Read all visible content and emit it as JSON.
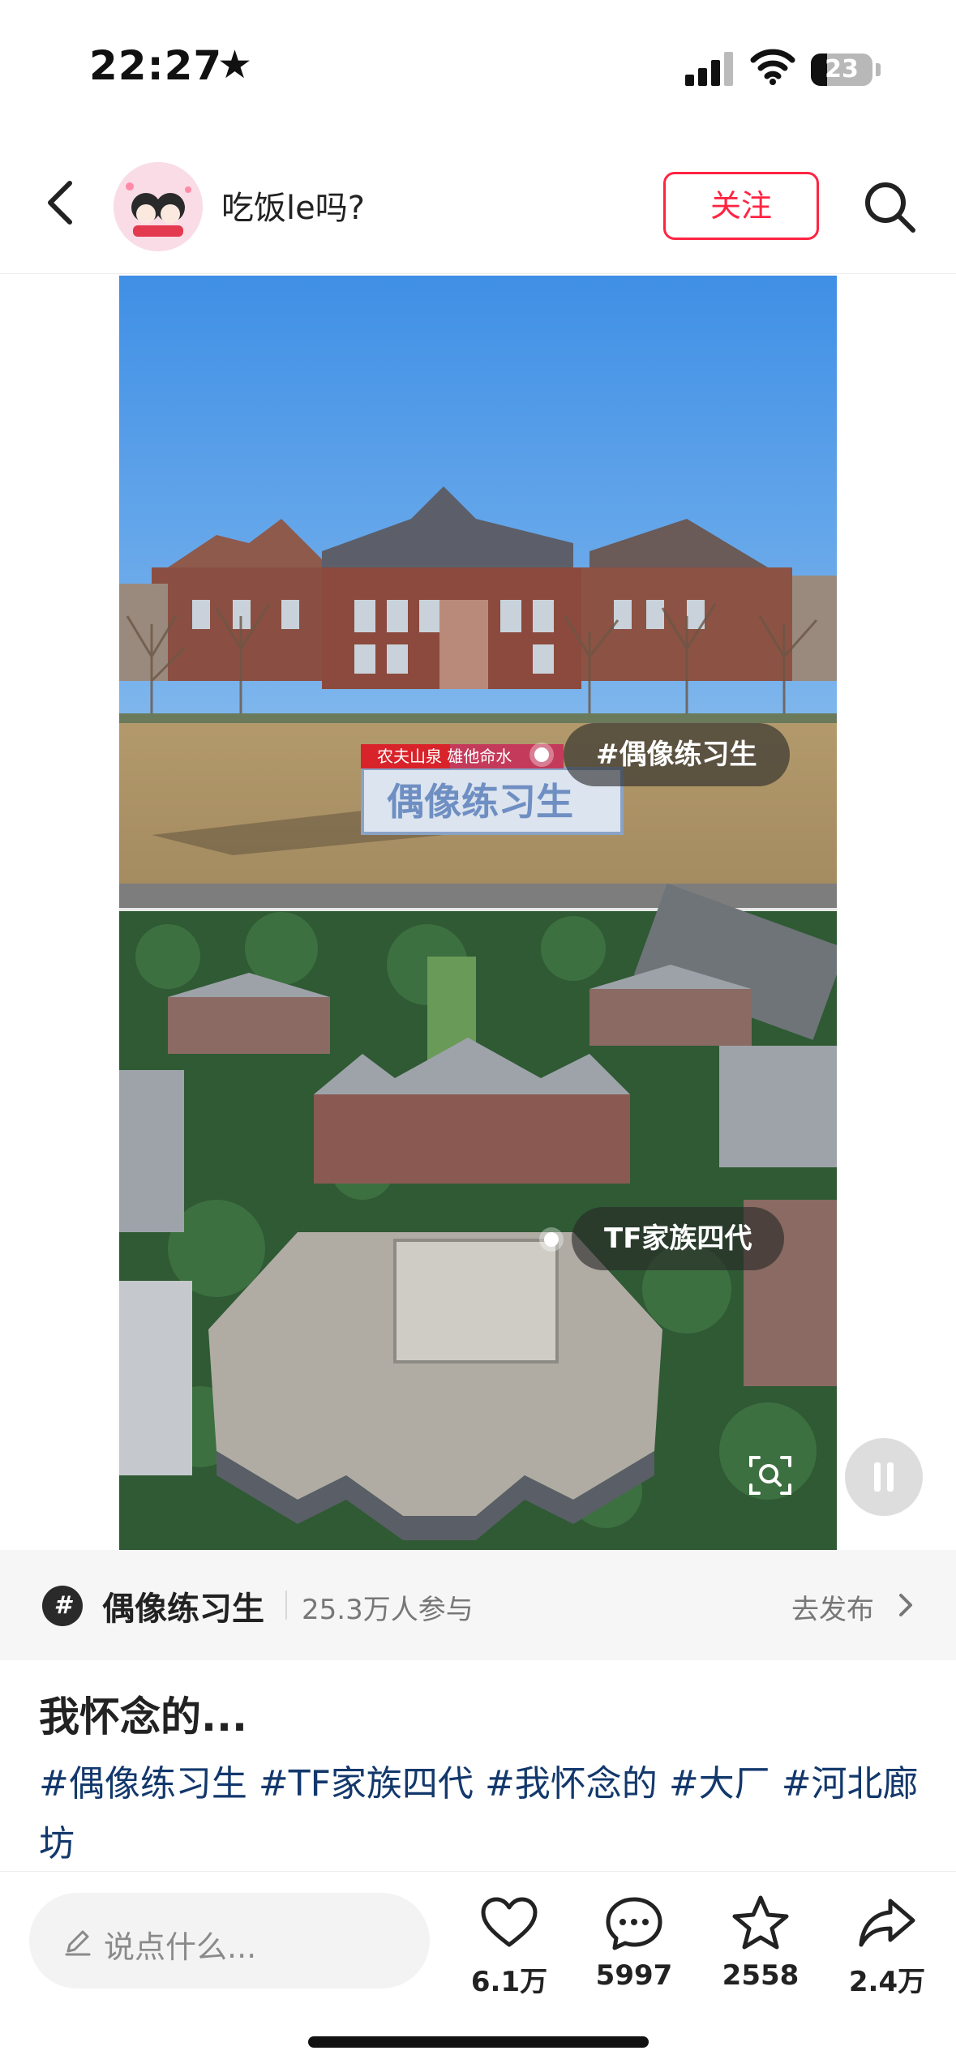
{
  "status_bar": {
    "time": "22:27",
    "star_icon": "star-icon",
    "battery": "23"
  },
  "header": {
    "author_name": "吃饭le吗?",
    "follow_label": "关注",
    "back_icon": "chevron-left-icon",
    "search_icon": "search-icon"
  },
  "media": {
    "sign_text_small": "农夫山泉  雄他命水",
    "sign_text_large": "偶像练习生",
    "tag_1": "#偶像练习生",
    "tag_2": "TF家族四代",
    "scan_icon": "scan-icon",
    "pause_icon": "pause-icon"
  },
  "topic": {
    "icon": "#",
    "name": "偶像练习生",
    "count": "25.3万人参与",
    "post_label": "去发布"
  },
  "note": {
    "title": "我怀念的...",
    "hashtags": [
      "#偶像练习生",
      "#TF家族四代",
      "#我怀念的",
      "#大厂",
      "#河北廊坊"
    ]
  },
  "bottom_bar": {
    "comment_placeholder": "说点什么...",
    "like_count": "6.1万",
    "comment_count": "5997",
    "collect_count": "2558",
    "share_count": "2.4万"
  },
  "colors": {
    "accent": "#ff2442",
    "hashtag": "#13386c",
    "topic_bg": "#f6f6f6"
  }
}
